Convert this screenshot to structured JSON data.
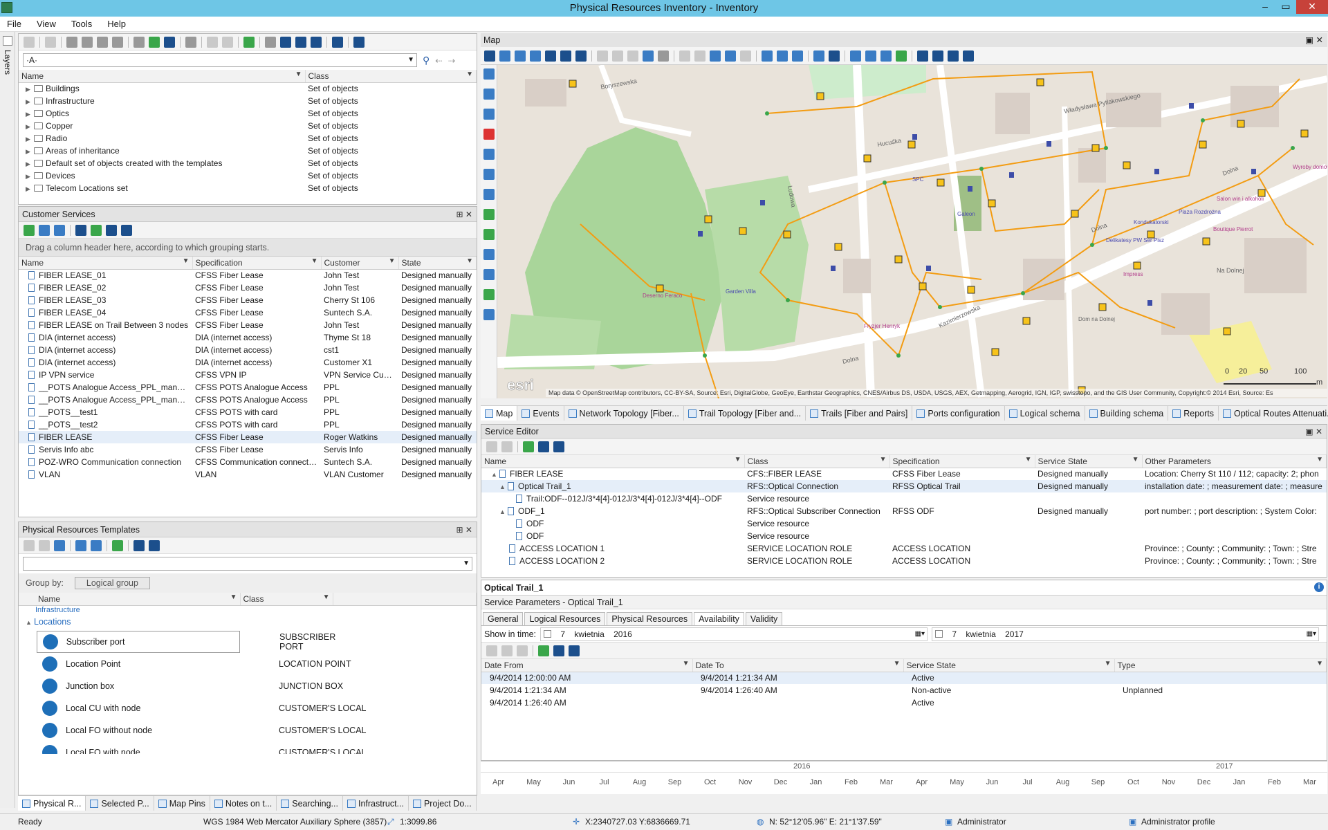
{
  "window": {
    "title": "Physical Resources Inventory - Inventory",
    "controls": [
      "–",
      "▭",
      "✕"
    ]
  },
  "menu": [
    "File",
    "View",
    "Tools",
    "Help"
  ],
  "sidebar": {
    "label": "Layers"
  },
  "layers": {
    "columns": [
      "Name",
      "Class"
    ],
    "rows": [
      {
        "name": "Buildings",
        "class": "Set of objects"
      },
      {
        "name": "Infrastructure",
        "class": "Set of objects"
      },
      {
        "name": "Optics",
        "class": "Set of objects"
      },
      {
        "name": "Copper",
        "class": "Set of objects"
      },
      {
        "name": "Radio",
        "class": "Set of objects"
      },
      {
        "name": "Areas of inheritance",
        "class": "Set of objects"
      },
      {
        "name": "Default set of objects created with the templates",
        "class": "Set of objects"
      },
      {
        "name": "Devices",
        "class": "Set of objects"
      },
      {
        "name": "Telecom Locations set",
        "class": "Set of objects"
      }
    ],
    "search_value": "·A·"
  },
  "customer_services": {
    "title": "Customer Services",
    "group_hint": "Drag a column header here, according to which grouping starts.",
    "columns": [
      "Name",
      "Specification",
      "Customer",
      "State"
    ],
    "rows": [
      {
        "name": "FIBER LEASE_01",
        "spec": "CFSS Fiber Lease",
        "customer": "John Test",
        "state": "Designed manually"
      },
      {
        "name": "FIBER LEASE_02",
        "spec": "CFSS Fiber Lease",
        "customer": "John Test",
        "state": "Designed manually"
      },
      {
        "name": "FIBER LEASE_03",
        "spec": "CFSS Fiber Lease",
        "customer": "Cherry St 106",
        "state": "Designed manually"
      },
      {
        "name": "FIBER LEASE_04",
        "spec": "CFSS Fiber Lease",
        "customer": "Suntech S.A.",
        "state": "Designed manually"
      },
      {
        "name": "FIBER LEASE on Trail Between 3 nodes",
        "spec": "CFSS Fiber Lease",
        "customer": "John Test",
        "state": "Designed manually"
      },
      {
        "name": "DIA (internet access)",
        "spec": "DIA (internet access)",
        "customer": "Thyme St 18",
        "state": "Designed manually"
      },
      {
        "name": "DIA (internet access)",
        "spec": "DIA (internet access)",
        "customer": "cst1",
        "state": "Designed manually"
      },
      {
        "name": "DIA (internet access)",
        "spec": "DIA (internet access)",
        "customer": "Customer X1",
        "state": "Designed manually"
      },
      {
        "name": "IP VPN service",
        "spec": "CFSS VPN IP",
        "customer": "VPN Service Custon",
        "state": "Designed manually"
      },
      {
        "name": "__POTS Analogue Access_PPL_manual1",
        "spec": "CFSS POTS Analogue Access",
        "customer": "PPL",
        "state": "Designed manually"
      },
      {
        "name": "__POTS Analogue Access_PPL_manual2",
        "spec": "CFSS POTS Analogue Access",
        "customer": "PPL",
        "state": "Designed manually"
      },
      {
        "name": "__POTS__test1",
        "spec": "CFSS POTS with card",
        "customer": "PPL",
        "state": "Designed manually"
      },
      {
        "name": "__POTS__test2",
        "spec": "CFSS POTS with card",
        "customer": "PPL",
        "state": "Designed manually"
      },
      {
        "name": "FIBER LEASE",
        "spec": "CFSS Fiber Lease",
        "customer": "Roger Watkins",
        "state": "Designed manually",
        "selected": true
      },
      {
        "name": "Servis Info abc",
        "spec": "CFSS Fiber Lease",
        "customer": "Servis Info",
        "state": "Designed manually"
      },
      {
        "name": "POZ-WRO Communication connection",
        "spec": "CFSS Communication connection",
        "customer": "Suntech S.A.",
        "state": "Designed manually"
      },
      {
        "name": "VLAN",
        "spec": "VLAN",
        "customer": "VLAN Customer",
        "state": "Designed manually"
      }
    ]
  },
  "templates": {
    "title": "Physical Resources Templates",
    "group_by_label": "Group by:",
    "group_by_value": "Logical group",
    "columns": [
      "Name",
      "Class"
    ],
    "partial_group": "Infrastructure",
    "group": "Locations",
    "rows": [
      {
        "name": "Subscriber port",
        "class": "SUBSCRIBER PORT"
      },
      {
        "name": "Location Point",
        "class": "LOCATION POINT"
      },
      {
        "name": "Junction box",
        "class": "JUNCTION BOX"
      },
      {
        "name": "Local CU with node",
        "class": "CUSTOMER'S LOCAL"
      },
      {
        "name": "Local FO without node",
        "class": "CUSTOMER'S LOCAL"
      },
      {
        "name": "Local FO with node",
        "class": "CUSTOMER'S LOCAL"
      }
    ]
  },
  "bottom_tabs": [
    "Physical R...",
    "Selected P...",
    "Map Pins",
    "Notes on t...",
    "Searching...",
    "Infrastruct...",
    "Project Do..."
  ],
  "map": {
    "title": "Map",
    "attribution": "Map data © OpenStreetMap contributors, CC-BY-SA, Source: Esri, DigitalGlobe, GeoEye, Earthstar Geographics, CNES/Airbus DS, USDA, USGS, AEX, Getmapping, Aerogrid, IGN, IGP, swisstopo, and the GIS User Community, Copyright:© 2014 Esri, Source: Es",
    "logo": "esri",
    "scale": {
      "labels": [
        "0",
        "20",
        "50",
        "100"
      ],
      "unit": "m"
    },
    "streets": [
      "Boryszewska",
      "Władysława Pytlakowskiego",
      "Dolna",
      "Dolna",
      "Dolna",
      "Kazimierzowska",
      "Ludowa",
      "Hucuśka"
    ],
    "pois": [
      "Garden Villa",
      "SPC",
      "Galeon",
      "Deserno Feraco",
      "Delikatesy PW Ser Pisz",
      "Impress",
      "Boutique Pierrot",
      "Salon win i alkoholi",
      "Wyroby domowe",
      "Na Dolnej",
      "Dom na Dolnej",
      "Fryzjer Henryk",
      "Plaza Rozdrożna",
      "Kondukatorski"
    ],
    "tabs": [
      "Map",
      "Events",
      "Network Topology [Fiber...",
      "Trail Topology [Fiber and...",
      "Trails [Fiber and Pairs]",
      "Ports configuration",
      "Logical schema",
      "Building schema",
      "Reports",
      "Optical Routes Attenuati..."
    ]
  },
  "service_editor": {
    "title": "Service Editor",
    "columns": [
      "Name",
      "Class",
      "Specification",
      "Service State",
      "Other Parameters"
    ],
    "rows": [
      {
        "name": "FIBER LEASE",
        "class": "CFS::FIBER LEASE",
        "spec": "CFSS Fiber Lease",
        "state": "Designed manually",
        "other": "Location: Cherry St 110 / 112;  capacity: 2;  phon"
      },
      {
        "name": "Optical Trail_1",
        "class": "RFS::Optical Connection",
        "spec": "RFSS Optical Trail",
        "state": "Designed manually",
        "other": "installation date: ;  measurement date: ;  measure"
      },
      {
        "name": "Trail:ODF--012J/3*4[4]-012J/3*4[4]-012J/3*4[4]--ODF",
        "class": "Service resource",
        "spec": "",
        "state": "",
        "other": ""
      },
      {
        "name": "ODF_1",
        "class": "RFS::Optical Subscriber Connection",
        "spec": "RFSS ODF",
        "state": "Designed manually",
        "other": "port number: ;  port description: ;  System Color:"
      },
      {
        "name": "ODF",
        "class": "Service resource",
        "spec": "",
        "state": "",
        "other": ""
      },
      {
        "name": "ODF",
        "class": "Service resource",
        "spec": "",
        "state": "",
        "other": ""
      },
      {
        "name": "ACCESS LOCATION 1",
        "class": "SERVICE LOCATION ROLE",
        "spec": "ACCESS LOCATION",
        "state": "",
        "other": "Province: ;  County: ;  Community: ;  Town: ;  Stre"
      },
      {
        "name": "ACCESS LOCATION 2",
        "class": "SERVICE LOCATION ROLE",
        "spec": "ACCESS LOCATION",
        "state": "",
        "other": "Province: ;  County: ;  Community: ;  Town: ;  Stre"
      }
    ]
  },
  "details": {
    "heading": "Optical Trail_1",
    "params_label": "Service Parameters - Optical Trail_1",
    "tabs": [
      "General",
      "Logical Resources",
      "Physical Resources",
      "Availability",
      "Validity"
    ],
    "show_in_time": "Show in time:",
    "from": {
      "day": "7",
      "month": "kwietnia",
      "year": "2016"
    },
    "to": {
      "day": "7",
      "month": "kwietnia",
      "year": "2017"
    },
    "columns": [
      "Date From",
      "Date To",
      "Service State",
      "Type"
    ],
    "rows": [
      {
        "from": "9/4/2014 12:00:00 AM",
        "to": "9/4/2014 1:21:34 AM",
        "state": "Active",
        "type": ""
      },
      {
        "from": "9/4/2014 1:21:34 AM",
        "to": "9/4/2014 1:26:40 AM",
        "state": "Non-active",
        "type": "Unplanned"
      },
      {
        "from": "9/4/2014 1:26:40 AM",
        "to": "",
        "state": "Active",
        "type": ""
      }
    ]
  },
  "timeline": {
    "years": [
      "2016",
      "2017"
    ],
    "months": [
      "Apr",
      "May",
      "Jun",
      "Jul",
      "Aug",
      "Sep",
      "Oct",
      "Nov",
      "Dec",
      "Jan",
      "Feb",
      "Mar",
      "Apr",
      "May",
      "Jun",
      "Jul",
      "Aug",
      "Sep",
      "Oct",
      "Nov",
      "Dec",
      "Jan",
      "Feb",
      "Mar"
    ]
  },
  "status": {
    "ready": "Ready",
    "crs": "WGS 1984 Web Mercator Auxiliary Sphere (3857)",
    "scale": "1:3099.86",
    "xy": "X:2340727.03 Y:6836669.71",
    "latlon": "N: 52°12'05.96\" E: 21°1'37.59\"",
    "user": "Administrator",
    "profile": "Administrator profile"
  },
  "colors": {
    "accent": "#6ec6e6",
    "network": "#f39c12",
    "selection": "#e5eef9"
  }
}
